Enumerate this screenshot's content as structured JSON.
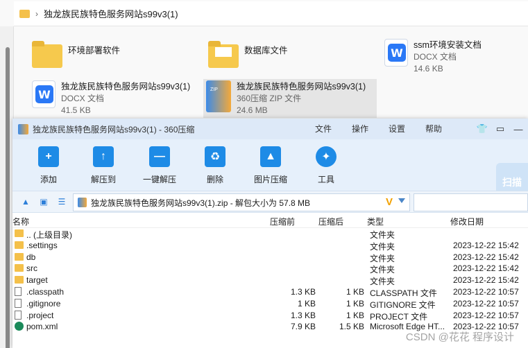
{
  "explorer": {
    "breadcrumb": [
      "独龙族民族特色服务网站s99v3(1)"
    ],
    "tiles": [
      {
        "name": "环境部署软件",
        "type": "",
        "size": "",
        "icon": "folder-icon"
      },
      {
        "name": "数据库文件",
        "type": "",
        "size": "",
        "icon": "folder-icon"
      },
      {
        "name": "ssm环境安装文档",
        "type": "DOCX 文档",
        "size": "14.6 KB",
        "icon": "docx-icon"
      },
      {
        "name": "独龙族民族特色服务网站s99v3(1)",
        "type": "DOCX 文档",
        "size": "41.5 KB",
        "icon": "docx-icon"
      },
      {
        "name": "独龙族民族特色服务网站s99v3(1)",
        "type": "360压缩 ZIP 文件",
        "size": "24.6 MB",
        "icon": "zip-icon"
      }
    ]
  },
  "app": {
    "title": "独龙族民族特色服务网站s99v3(1) - 360压缩",
    "menus": [
      "文件",
      "操作",
      "设置",
      "帮助"
    ],
    "tools": [
      {
        "label": "添加",
        "icon": "add-icon",
        "glyph": "+"
      },
      {
        "label": "解压到",
        "icon": "extract-to-icon",
        "glyph": "↑"
      },
      {
        "label": "一键解压",
        "icon": "one-click-extract-icon",
        "glyph": "—"
      },
      {
        "label": "删除",
        "icon": "delete-icon",
        "glyph": "♻"
      },
      {
        "label": "图片压缩",
        "icon": "image-compress-icon",
        "glyph": "▲"
      },
      {
        "label": "工具",
        "icon": "tools-icon",
        "glyph": "✦"
      }
    ],
    "scan_label": "扫描",
    "path_text": "独龙族民族特色服务网站s99v3(1).zip - 解包大小为 57.8 MB",
    "columns": {
      "name": "名称",
      "before": "压缩前",
      "after": "压缩后",
      "type": "类型",
      "modified": "修改日期"
    },
    "rows": [
      {
        "name": ".. (上级目录)",
        "before": "",
        "after": "",
        "type": "文件夹",
        "modified": "",
        "kind": "folder"
      },
      {
        "name": ".settings",
        "before": "",
        "after": "",
        "type": "文件夹",
        "modified": "2023-12-22 15:42",
        "kind": "folder"
      },
      {
        "name": "db",
        "before": "",
        "after": "",
        "type": "文件夹",
        "modified": "2023-12-22 15:42",
        "kind": "folder"
      },
      {
        "name": "src",
        "before": "",
        "after": "",
        "type": "文件夹",
        "modified": "2023-12-22 15:42",
        "kind": "folder"
      },
      {
        "name": "target",
        "before": "",
        "after": "",
        "type": "文件夹",
        "modified": "2023-12-22 15:42",
        "kind": "folder"
      },
      {
        "name": ".classpath",
        "before": "1.3 KB",
        "after": "1 KB",
        "type": "CLASSPATH 文件",
        "modified": "2023-12-22 10:57",
        "kind": "doc"
      },
      {
        "name": ".gitignore",
        "before": "1 KB",
        "after": "1 KB",
        "type": "GITIGNORE 文件",
        "modified": "2023-12-22 10:57",
        "kind": "doc"
      },
      {
        "name": ".project",
        "before": "1.3 KB",
        "after": "1 KB",
        "type": "PROJECT 文件",
        "modified": "2023-12-22 10:57",
        "kind": "doc"
      },
      {
        "name": "pom.xml",
        "before": "7.9 KB",
        "after": "1.5 KB",
        "type": "Microsoft Edge HT...",
        "modified": "2023-12-22 10:57",
        "kind": "edge"
      }
    ]
  },
  "watermark": "CSDN @花花 程序设计"
}
